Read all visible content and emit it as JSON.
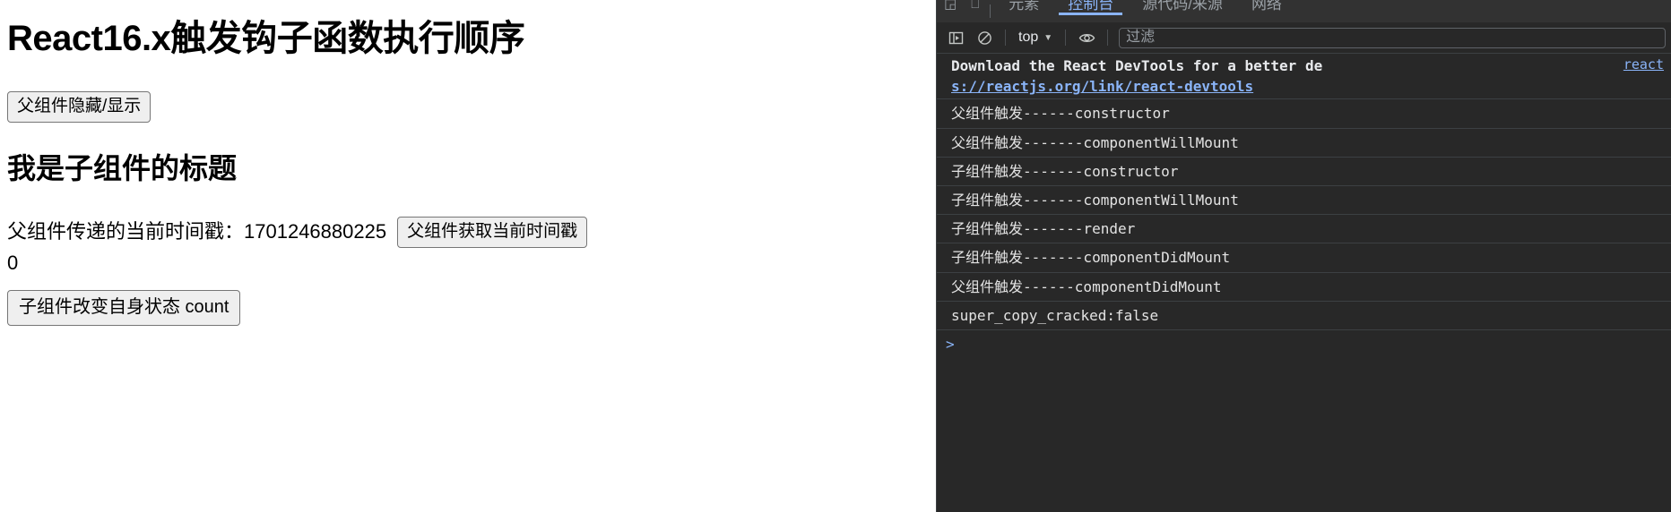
{
  "page": {
    "title": "React16.x触发钩子函数执行顺序",
    "toggle_button": "父组件隐藏/显示",
    "child_title": "我是子组件的标题",
    "timestamp_label": "父组件传递的当前时间戳：",
    "timestamp_value": "1701246880225",
    "fetch_time_button": "父组件获取当前时间戳",
    "count_value": "0",
    "count_button": "子组件改变自身状态 count"
  },
  "devtools": {
    "tabs": [
      {
        "label": "元素",
        "active": false
      },
      {
        "label": "控制台",
        "active": true
      },
      {
        "label": "源代码/来源",
        "active": false
      },
      {
        "label": "网络",
        "active": false
      }
    ],
    "toolbar": {
      "sidebar_toggle_icon": "console-sidebar-icon",
      "clear_icon": "clear-console-icon",
      "context": "top",
      "context_caret_icon": "chevron-down-icon",
      "eye_icon": "live-expression-icon",
      "filter_placeholder": "过滤"
    },
    "console": {
      "source_link": "react",
      "warning": {
        "line1": "Download the React DevTools for a better de",
        "line2": "s://reactjs.org/link/react-devtools"
      },
      "logs": [
        "父组件触发------constructor",
        "父组件触发-------componentWillMount",
        "子组件触发-------constructor",
        "子组件触发-------componentWillMount",
        "子组件触发-------render",
        "子组件触发-------componentDidMount",
        "父组件触发------componentDidMount",
        "super_copy_cracked:false"
      ],
      "prompt": ">"
    }
  },
  "colors": {
    "devtools_bg": "#282828",
    "devtools_tabbar_bg": "#323232",
    "accent_blue": "#8ab4f8",
    "log_text": "#e3e3e3",
    "button_face": "#efefef",
    "button_border": "#767676"
  }
}
